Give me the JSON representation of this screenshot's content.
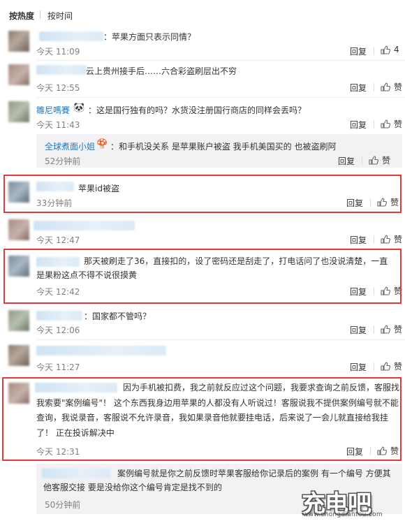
{
  "sort": {
    "hot": "按热度",
    "time": "按时间"
  },
  "labels": {
    "reply": "回复",
    "like": "赞"
  },
  "comments": [
    {
      "text": "：苹果方面只表示同情？",
      "time": "今天 11:09",
      "likes": "4"
    },
    {
      "text": "云上贵州接手后……六合彩盗刷层出不穷",
      "time": "今天 12:55"
    },
    {
      "nick": "雛尼嗎賽",
      "emoji": "🐼",
      "text": "：这是国行独有的吗？水货没注册国行商店的同样会丢吗？",
      "time": "今天 11:43",
      "sub": {
        "nick": "全球煮面小姐",
        "emoji": "🍄",
        "text": "：和手机没关系 是苹果账户被盗 我手机美国买的 也被盗刷阿",
        "time": "52分钟前"
      }
    },
    {
      "text": "苹果id被盗",
      "time": "33分钟前"
    },
    {
      "text": "",
      "time": "今天 12:47"
    },
    {
      "text": "那天被刷走了36，直接扣的，设了密码还是刮走了，打电话问了也没说清楚，一直是果粉这点不得不说很摸黄",
      "time": "今天 12:42"
    },
    {
      "text": "：国家都不管吗？",
      "time": "今天 12:06"
    },
    {
      "text": "",
      "time": "今天 11:27"
    },
    {
      "text": "因为手机被扣费，我之前就反应过这个问题，我要求查询之前反馈，客服找我索要\"案例编号\"！ 这个东西我身边用苹果的人都没有人听说过！客服说我不提供案例编号就不能查询，我说录音，客服说不允许录音，我如果录音他就要挂电话，后来说了一会儿就直接给我挂了！ 正在投诉解决中",
      "time": "今天 12:31",
      "sub": {
        "text": "案例编号就是你之前反馈时苹果客服给你记录后的案例 有一个编号 方便其他客服交接 要是没给你这个编号肯定是找不到的",
        "time": "50分钟前"
      }
    }
  ],
  "watermark": {
    "logo": "充电吧",
    "url": "www.chongdiantou.com"
  }
}
